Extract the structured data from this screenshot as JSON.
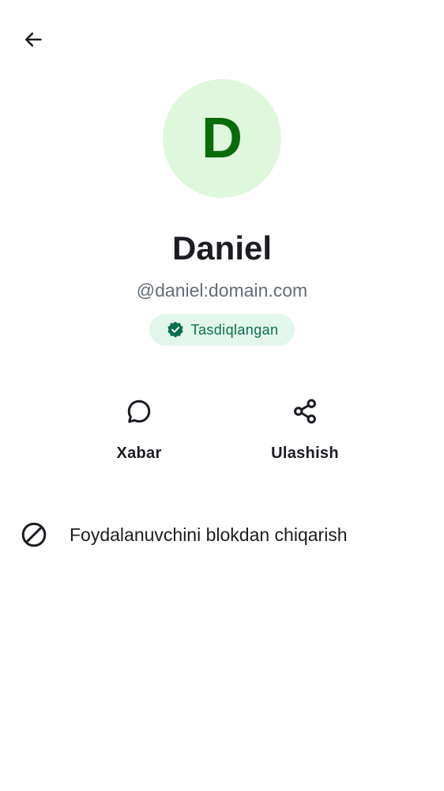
{
  "header": {
    "back_icon": "arrow-left-icon"
  },
  "profile": {
    "avatar_initial": "D",
    "avatar_bg_color": "#dff7dc",
    "avatar_fg_color": "#0a6b0a",
    "display_name": "Daniel",
    "user_id": "@daniel:domain.com",
    "verified_label": "Tasdiqlangan",
    "verified_icon": "shield-check-icon",
    "verified_color": "#0a6e4f"
  },
  "actions": [
    {
      "label": "Xabar",
      "icon": "chat-bubble-icon"
    },
    {
      "label": "Ulashish",
      "icon": "share-icon"
    }
  ],
  "list": [
    {
      "label": "Foydalanuvchini blokdan chiqarish",
      "icon": "block-icon"
    }
  ]
}
